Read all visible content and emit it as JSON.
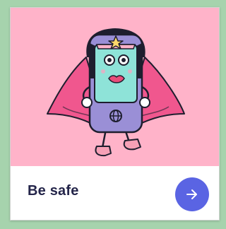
{
  "card": {
    "title": "Be safe",
    "action_icon": "arrow-right-icon",
    "illustration": "superhero-phone-illustration"
  },
  "colors": {
    "page_background": "#a6d3ad",
    "illustration_background": "#ffb3c9",
    "cape": "#f0578e",
    "phone_screen": "#8ee3d8",
    "phone_body": "#9a8fd6",
    "title_text": "#24254a",
    "button": "#5a64e3"
  }
}
